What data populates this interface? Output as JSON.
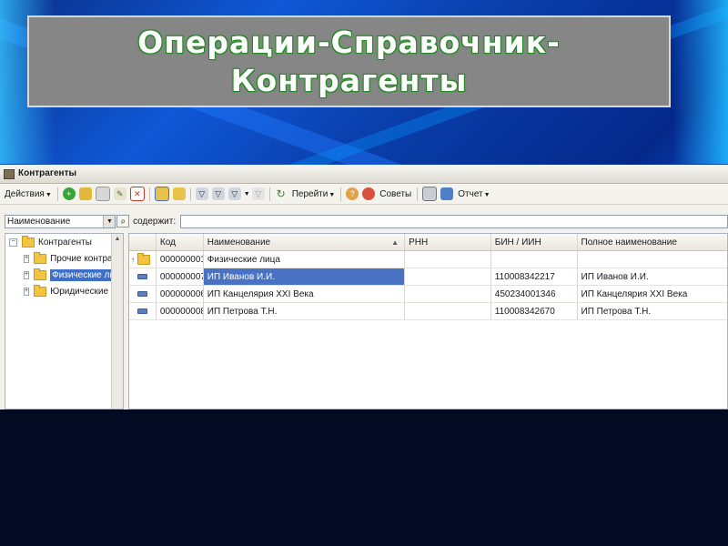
{
  "slide": {
    "title_line1": "Операции-Справочник-",
    "title_line2": "Контрагенты"
  },
  "window": {
    "title": "Контрагенты"
  },
  "toolbar": {
    "actions_label": "Действия",
    "goto_label": "Перейти",
    "tips_label": "Советы",
    "report_label": "Отчет"
  },
  "filter": {
    "field_value": "Наименование",
    "contains_label": "содержит:",
    "contains_value": ""
  },
  "tree": {
    "root": "Контрагенты",
    "items": [
      {
        "label": "Прочие контрагенты"
      },
      {
        "label": "Физические лица"
      },
      {
        "label": "Юридические лица"
      }
    ]
  },
  "grid": {
    "headers": {
      "code": "Код",
      "name": "Наименование",
      "rnn": "РНН",
      "bin": "БИН / ИИН",
      "full": "Полное наименование"
    },
    "group_row": {
      "code": "000000001",
      "name": "Физические лица"
    },
    "rows": [
      {
        "code": "000000007",
        "name": "ИП Иванов И.И.",
        "rnn": "",
        "bin": "110008342217",
        "full": "ИП Иванов И.И."
      },
      {
        "code": "000000006",
        "name": "ИП Канцелярия XXI Века",
        "rnn": "",
        "bin": "450234001346",
        "full": "ИП Канцелярия XXI Века"
      },
      {
        "code": "000000008",
        "name": "ИП Петрова Т.Н.",
        "rnn": "",
        "bin": "110008342670",
        "full": "ИП Петрова Т.Н."
      }
    ]
  },
  "colors": {
    "selection": "#4a72c4",
    "title_box": "#868686"
  }
}
